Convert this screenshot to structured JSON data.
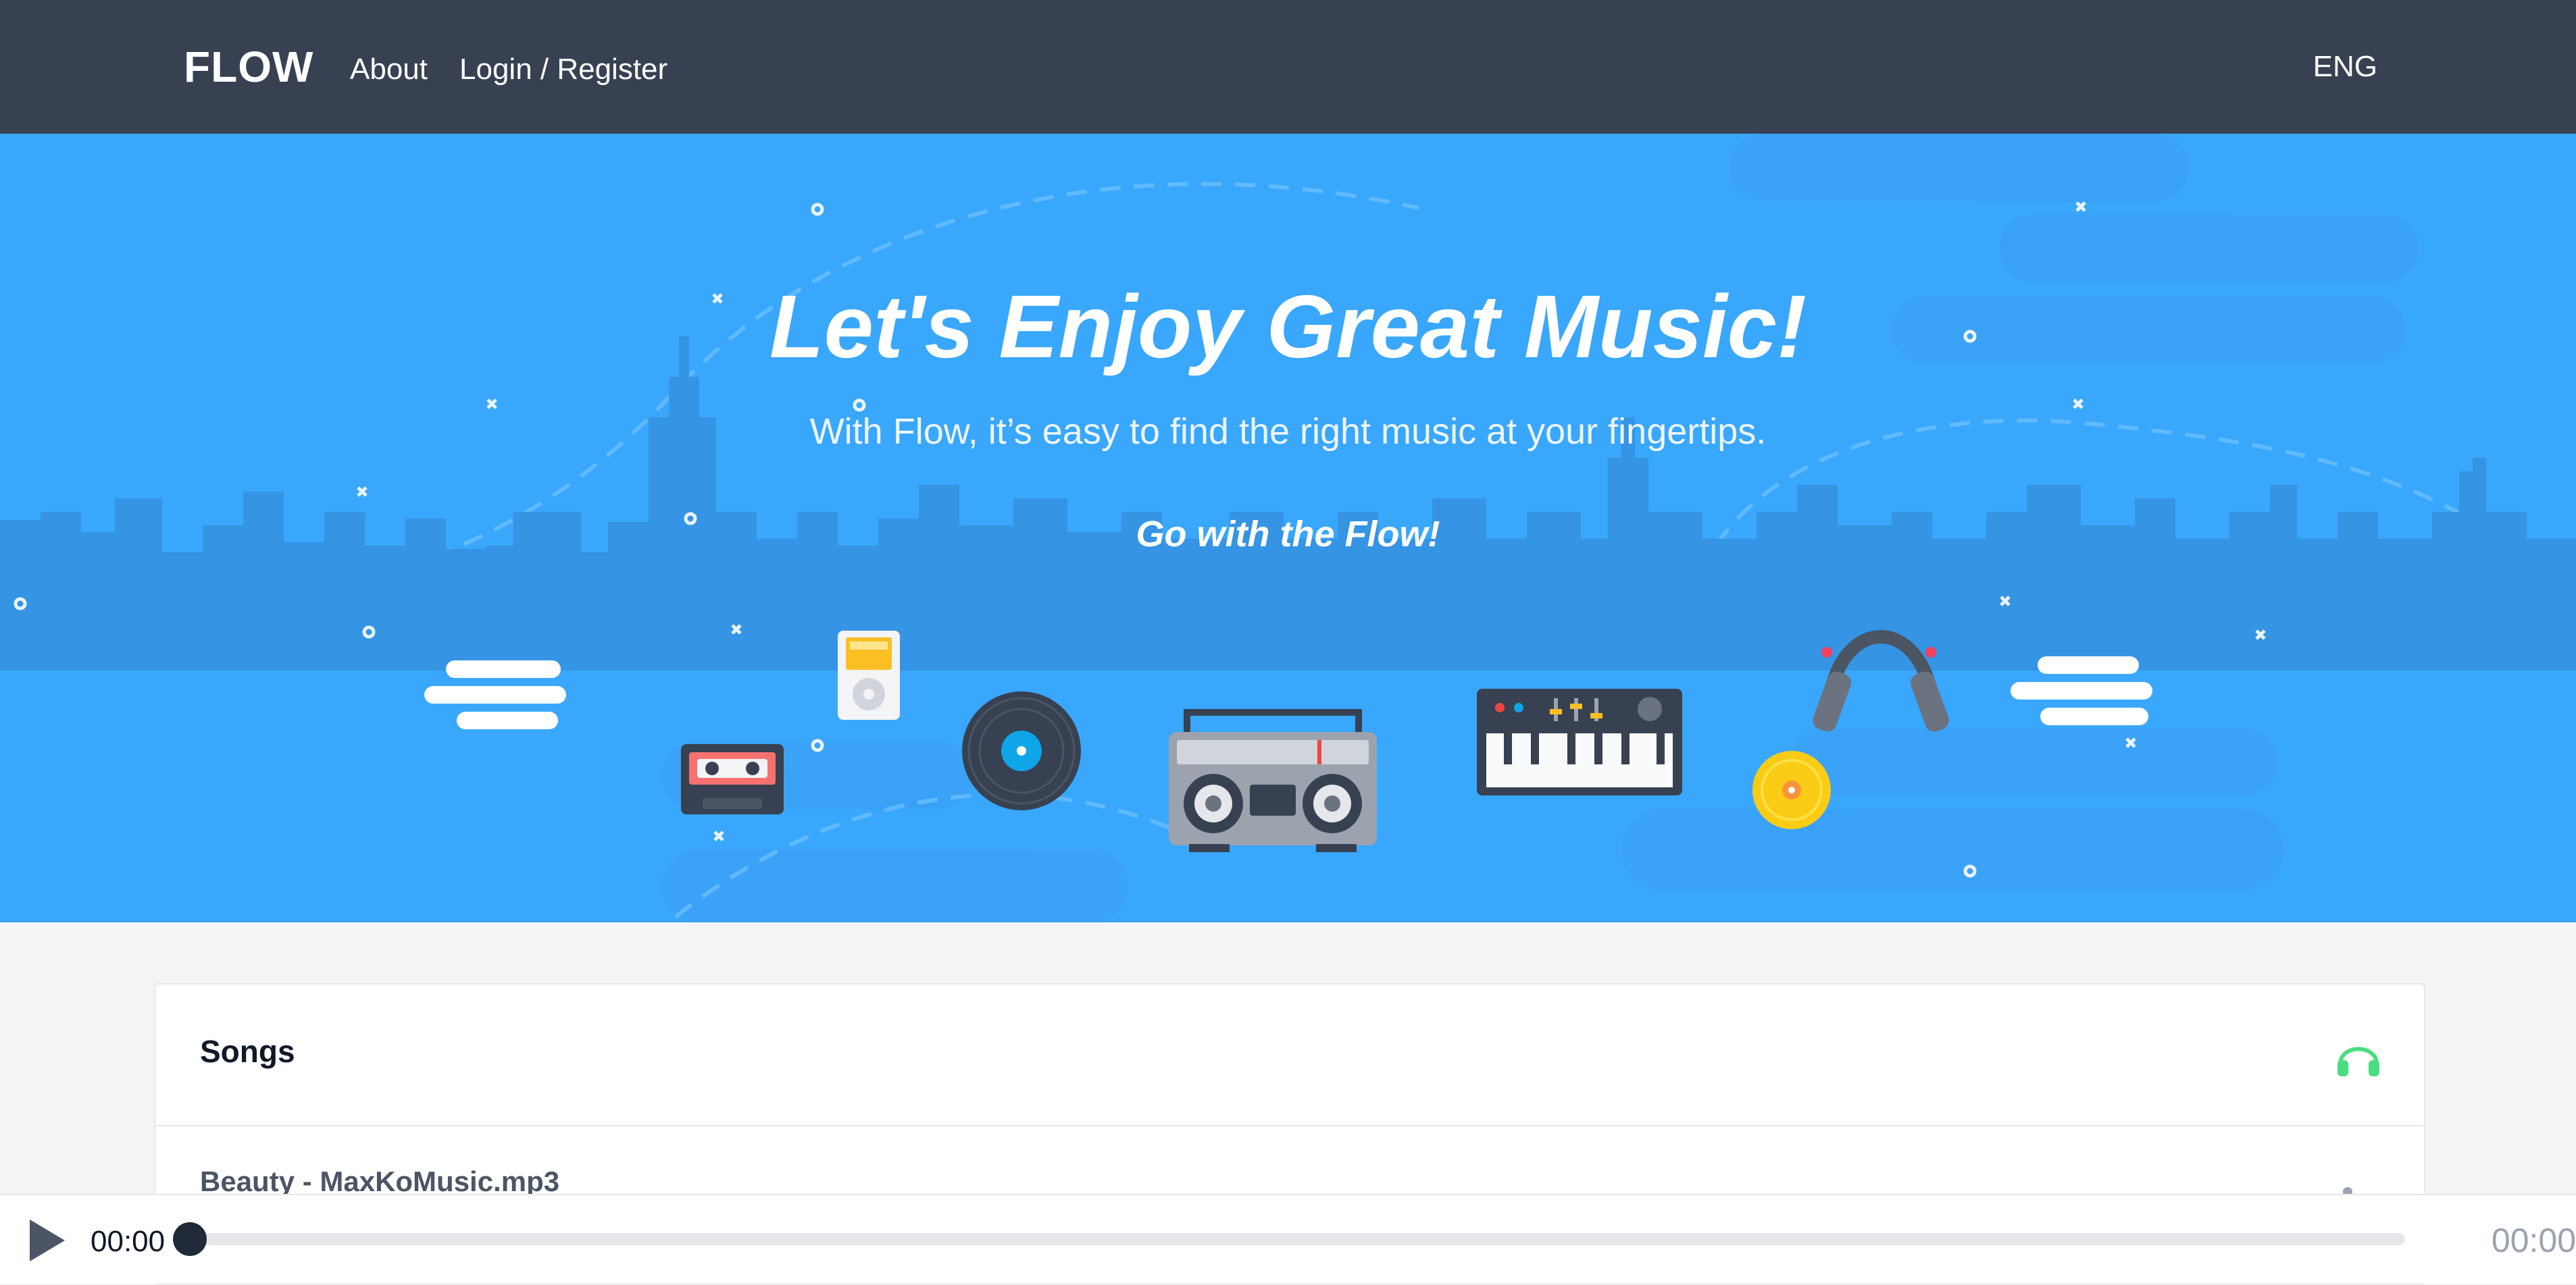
{
  "navbar": {
    "brand": "FLOW",
    "links": [
      {
        "label": "About"
      },
      {
        "label": "Login / Register"
      }
    ],
    "language": "ENG"
  },
  "hero": {
    "title": "Let's Enjoy Great Music!",
    "subtitle": "With Flow, it’s easy to find the right music at your fingertips.",
    "tagline": "Go with the Flow!",
    "illustrations": [
      "cloud-icon",
      "cassette-icon",
      "ipod-icon",
      "vinyl-record-icon",
      "boombox-icon",
      "synthesizer-icon",
      "cd-icon",
      "headphones-icon",
      "cloud-icon"
    ]
  },
  "songs": {
    "title": "Songs",
    "header_icon": "headphones-icon",
    "items": [
      {
        "name": "Beauty - MaxKoMusic.mp3"
      }
    ]
  },
  "player": {
    "current_time": "00:00",
    "total_time": "00:00",
    "progress": 0,
    "play_icon": "play-icon"
  },
  "colors": {
    "navbar": "#374151",
    "hero": "#39a7fc",
    "accent_green": "#4ade80",
    "page_bg": "#f3f4f6"
  }
}
